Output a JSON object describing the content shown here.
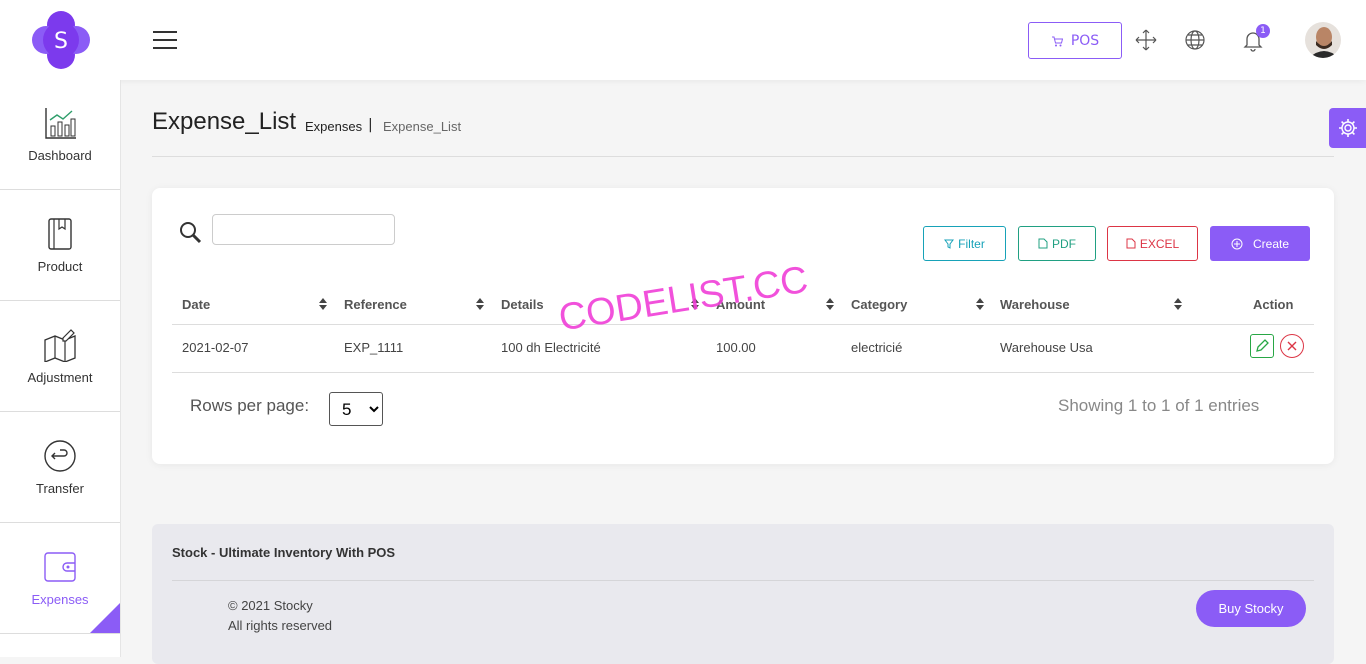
{
  "header": {
    "logo_letter": "S",
    "pos_label": "POS",
    "notification_count": "1"
  },
  "sidebar": {
    "items": [
      {
        "label": "Dashboard",
        "icon": "chart-icon"
      },
      {
        "label": "Product",
        "icon": "book-icon"
      },
      {
        "label": "Adjustment",
        "icon": "map-edit-icon"
      },
      {
        "label": "Transfer",
        "icon": "return-icon"
      },
      {
        "label": "Expenses",
        "icon": "wallet-icon",
        "active": true
      }
    ]
  },
  "page": {
    "title": "Expense_List",
    "breadcrumb_parent": "Expenses",
    "breadcrumb_sep": "|",
    "breadcrumb_current": "Expense_List"
  },
  "toolbar": {
    "search_placeholder": "",
    "filter_label": "Filter",
    "pdf_label": "PDF",
    "excel_label": "EXCEL",
    "create_label": "Create"
  },
  "table": {
    "columns": [
      "Date",
      "Reference",
      "Details",
      "Amount",
      "Category",
      "Warehouse",
      "Action"
    ],
    "rows": [
      {
        "date": "2021-02-07",
        "reference": "EXP_1111",
        "details": "100 dh Electricité",
        "amount": "100.00",
        "category": "electricié",
        "warehouse": "Warehouse Usa"
      }
    ]
  },
  "pagination": {
    "rows_per_page_label": "Rows per page:",
    "rows_per_page_value": "5",
    "showing": "Showing 1 to 1 of 1 entries"
  },
  "watermark": "CODELIST.CC",
  "footer": {
    "title": "Stock - Ultimate Inventory With POS",
    "copyright": "© 2021 Stocky",
    "rights": "All rights reserved",
    "buy_label": "Buy Stocky"
  },
  "colors": {
    "accent": "#8b5cf6",
    "info": "#17a2b8",
    "success": "#20a082",
    "danger": "#dc3545"
  }
}
